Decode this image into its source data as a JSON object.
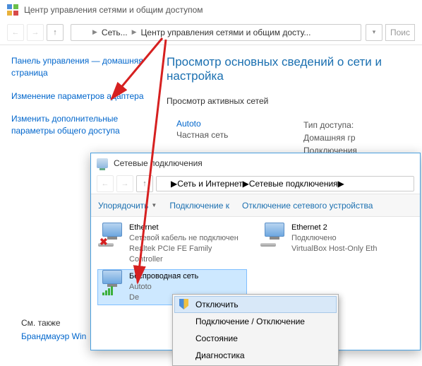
{
  "win1": {
    "title": "Центр управления сетями и общим доступом",
    "bc1": "Сеть...",
    "bc2": "Центр управления сетями и общим досту...",
    "search_ph": "Поис",
    "left": {
      "home": "Панель управления — домашняя страница",
      "adapter": "Изменение параметров адаптера",
      "sharing": "Изменить дополнительные параметры общего доступа"
    },
    "right": {
      "h": "Просмотр основных сведений о сети и настройка",
      "sub": "Просмотр активных сетей",
      "net_name": "Autoto",
      "net_type": "Частная сеть",
      "col2_l1": "Тип доступа:",
      "col2_l2": "Домашняя гр",
      "col2_l3": "Подключения"
    },
    "footer1": "См. также",
    "footer2": "Брандмауэр Win"
  },
  "win2": {
    "title": "Сетевые подключения",
    "bc1": "Сеть и Интернет",
    "bc2": "Сетевые подключения",
    "tb1": "Упорядочить",
    "tb2": "Подключение к",
    "tb3": "Отключение сетевого устройства",
    "adapters": [
      {
        "name": "Ethernet",
        "stat": "Сетевой кабель не подключен",
        "drv": "Realtek PCIe FE Family Controller"
      },
      {
        "name": "Ethernet 2",
        "stat": "Подключено",
        "drv": "VirtualBox Host-Only Eth"
      },
      {
        "name": "Беспроводная сеть",
        "stat": "Autoto",
        "drv": "De"
      }
    ]
  },
  "menu": {
    "i1": "Отключить",
    "i2": "Подключение / Отключение",
    "i3": "Состояние",
    "i4": "Диагностика"
  }
}
